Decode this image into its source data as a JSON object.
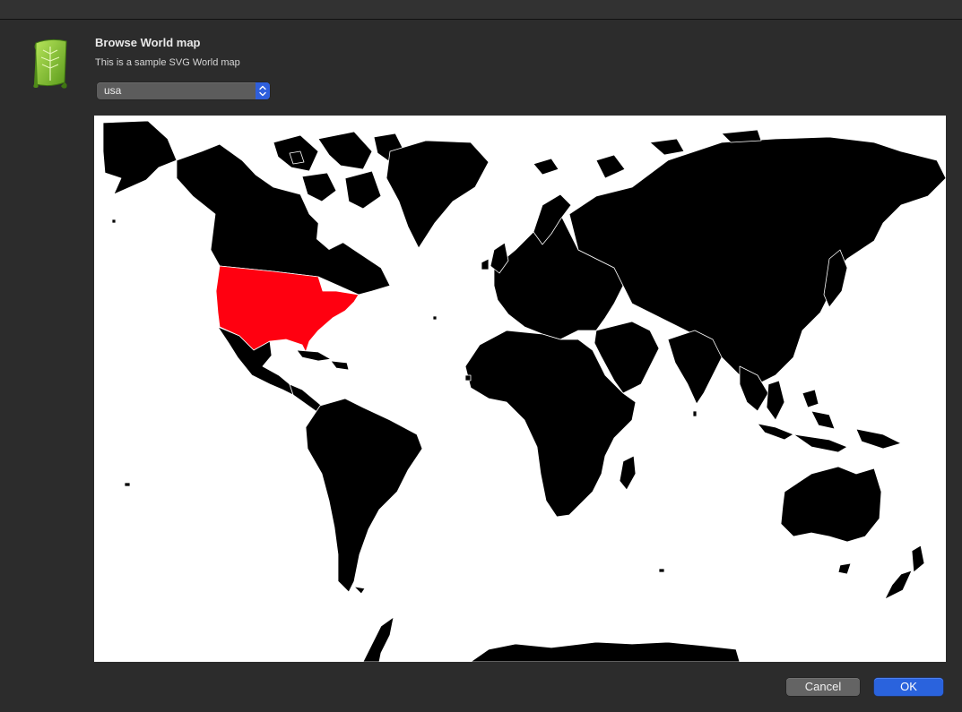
{
  "dialog": {
    "title": "Browse World map",
    "subtitle": "This is a sample SVG World map"
  },
  "country_select": {
    "selected": "usa"
  },
  "map": {
    "land_color": "#000000",
    "border_color": "#ffffff",
    "ocean_color": "#ffffff",
    "highlight_color": "#ff0010",
    "highlighted_country": "usa"
  },
  "buttons": {
    "cancel_label": "Cancel",
    "ok_label": "OK"
  },
  "colors": {
    "window_bg": "#2c2c2c",
    "accent": "#2a63dd"
  },
  "icons": {
    "app": "green-scroll-icon",
    "select_arrows": "chevron-up-down-icon"
  }
}
